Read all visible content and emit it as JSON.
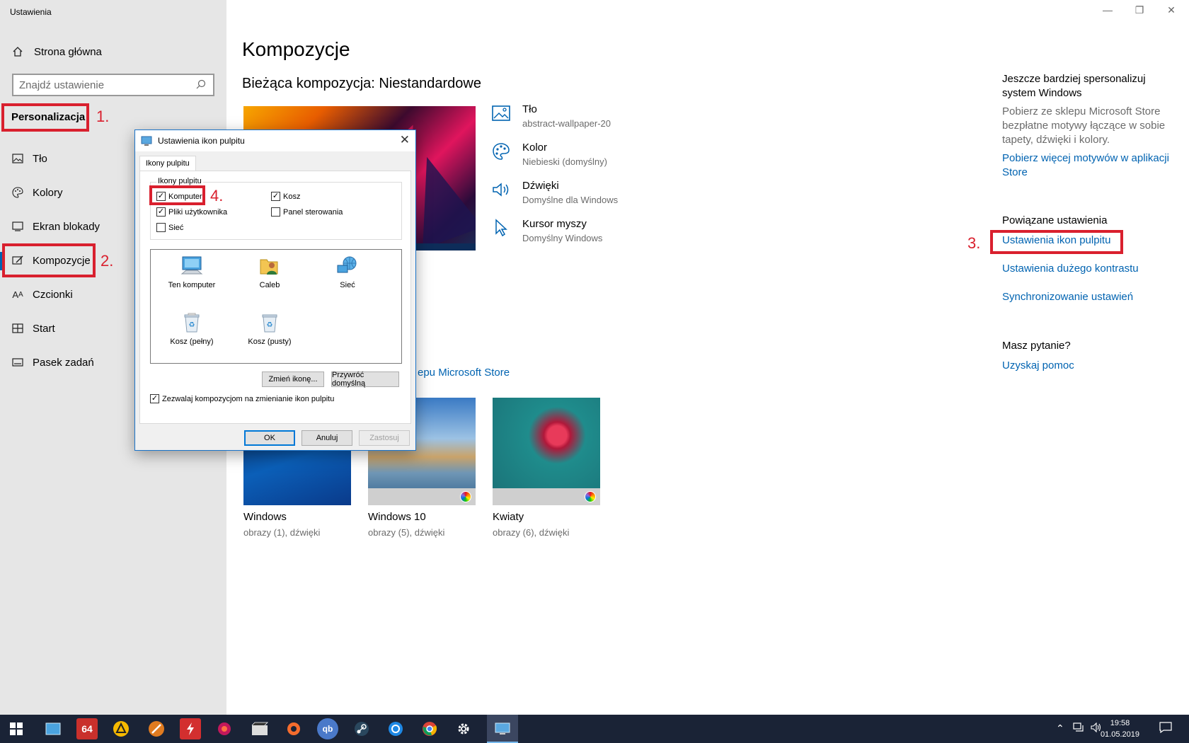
{
  "app": {
    "title": "Ustawienia"
  },
  "sidebar": {
    "home": "Strona główna",
    "search_placeholder": "Znajdź ustawienie",
    "section": "Personalizacja",
    "items": [
      {
        "label": "Tło",
        "icon": "image-icon"
      },
      {
        "label": "Kolory",
        "icon": "palette-icon"
      },
      {
        "label": "Ekran blokady",
        "icon": "lock-screen-icon"
      },
      {
        "label": "Kompozycje",
        "icon": "themes-icon"
      },
      {
        "label": "Czcionki",
        "icon": "fonts-icon"
      },
      {
        "label": "Start",
        "icon": "start-icon"
      },
      {
        "label": "Pasek zadań",
        "icon": "taskbar-icon"
      }
    ],
    "active": "Kompozycje"
  },
  "annotations": {
    "n1": "1.",
    "n2": "2.",
    "n3": "3.",
    "n4": "4.",
    "color": "#d9202e"
  },
  "main": {
    "title": "Kompozycje",
    "current": "Bieżąca kompozycja: Niestandardowe",
    "props": [
      {
        "title": "Tło",
        "sub": "abstract-wallpaper-20"
      },
      {
        "title": "Kolor",
        "sub": "Niebieski (domyślny)"
      },
      {
        "title": "Dźwięki",
        "sub": "Domyślne dla Windows"
      },
      {
        "title": "Kursor myszy",
        "sub": "Domyślny Windows"
      }
    ],
    "store_link": "epu Microsoft Store",
    "themes": [
      {
        "name": "Windows",
        "sub": "obrazy (1), dźwięki"
      },
      {
        "name": "Windows 10",
        "sub": "obrazy (5), dźwięki"
      },
      {
        "name": "Kwiaty",
        "sub": "obrazy (6), dźwięki"
      }
    ]
  },
  "right": {
    "personalize_title": "Jeszcze bardziej spersonalizuj system Windows",
    "personalize_text": "Pobierz ze sklepu Microsoft Store bezpłatne motywy łączące w sobie tapety, dźwięki i kolory.",
    "personalize_link": "Pobierz więcej motywów w aplikacji Store",
    "related_title": "Powiązane ustawienia",
    "related_links": [
      "Ustawienia ikon pulpitu",
      "Ustawienia dużego kontrastu",
      "Synchronizowanie ustawień"
    ],
    "question_title": "Masz pytanie?",
    "help_link": "Uzyskaj pomoc"
  },
  "dialog": {
    "title": "Ustawienia ikon pulpitu",
    "tab": "Ikony pulpitu",
    "group": "Ikony pulpitu",
    "checkboxes": [
      {
        "label": "Komputer",
        "checked": true
      },
      {
        "label": "Kosz",
        "checked": true
      },
      {
        "label": "Pliki użytkownika",
        "checked": true
      },
      {
        "label": "Panel sterowania",
        "checked": false
      },
      {
        "label": "Sieć",
        "checked": false
      }
    ],
    "icons": [
      "Ten komputer",
      "Caleb",
      "Sieć",
      "Kosz (pełny)",
      "Kosz (pusty)"
    ],
    "change_icon": "Zmień ikonę...",
    "restore_default": "Przywróć domyślną",
    "allow_themes": "Zezwalaj kompozycjom na zmienianie ikon pulpitu",
    "allow_themes_checked": true,
    "ok": "OK",
    "cancel": "Anuluj",
    "apply": "Zastosuj"
  },
  "taskbar": {
    "time": "19:58",
    "date": "01.05.2019",
    "apps": [
      "aida64-icon",
      "alarm-icon",
      "brush-icon",
      "flash-icon",
      "game-icon",
      "film-icon",
      "origin-icon",
      "qbittorrent-icon",
      "steam-icon",
      "network-icon",
      "chrome-icon",
      "settings-icon",
      "desktop-icons-icon"
    ],
    "app_labels": {
      "aida": "64",
      "qb": "qb"
    }
  }
}
